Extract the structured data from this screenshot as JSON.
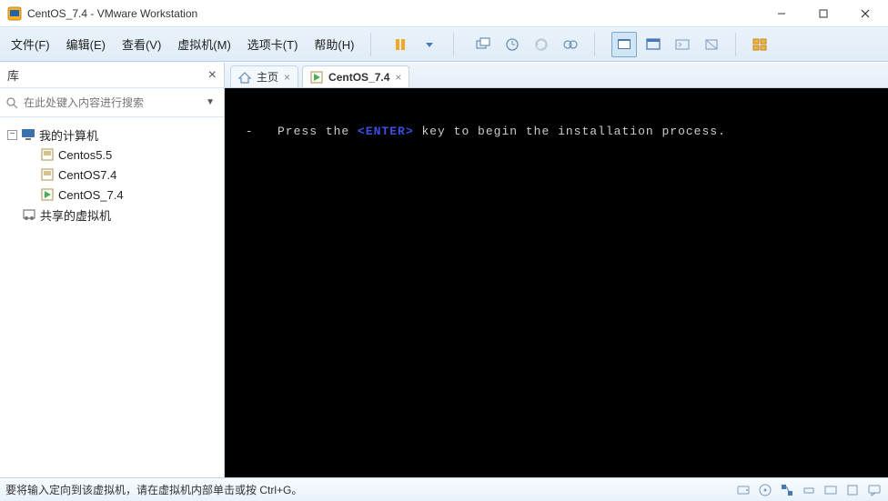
{
  "window": {
    "title": "CentOS_7.4 - VMware Workstation"
  },
  "menu": {
    "file": "文件(F)",
    "edit": "编辑(E)",
    "view": "查看(V)",
    "vm": "虚拟机(M)",
    "tabs": "选项卡(T)",
    "help": "帮助(H)"
  },
  "sidebar": {
    "title": "库",
    "search_placeholder": "在此处键入内容进行搜索",
    "nodes": {
      "mycomputer": "我的计算机",
      "vm1": "Centos5.5",
      "vm2": "CentOS7.4",
      "vm3": "CentOS_7.4",
      "shared": "共享的虚拟机"
    }
  },
  "tabs": {
    "home": "主页",
    "active": "CentOS_7.4"
  },
  "console": {
    "prefix": " -   Press the ",
    "enter": "<ENTER>",
    "suffix": " key to begin the installation process."
  },
  "status": {
    "text": "要将输入定向到该虚拟机，请在虚拟机内部单击或按 Ctrl+G。"
  }
}
